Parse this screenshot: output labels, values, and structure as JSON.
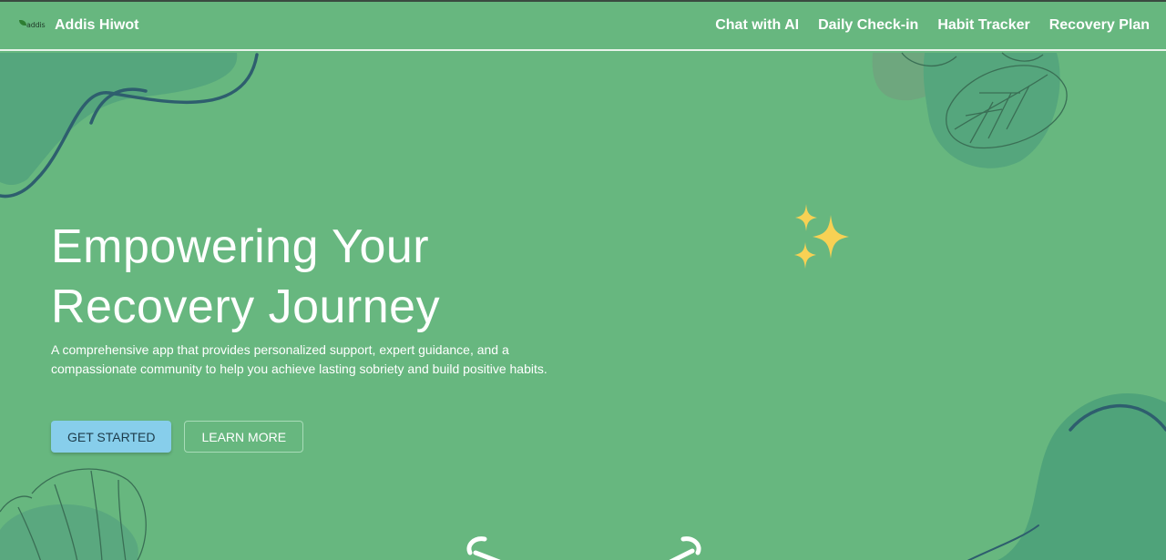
{
  "brand": {
    "logo_text": "addis",
    "name": "Addis Hiwot"
  },
  "nav": {
    "items": [
      {
        "label": "Chat with AI"
      },
      {
        "label": "Daily Check-in"
      },
      {
        "label": "Habit Tracker"
      },
      {
        "label": "Recovery Plan"
      }
    ]
  },
  "hero": {
    "title_line1": "Empowering Your",
    "title_line2": "Recovery Journey",
    "description": "A comprehensive app that provides personalized support, expert guidance, and a compassionate community to help you achieve lasting sobriety and build positive habits.",
    "primary_button": "GET STARTED",
    "secondary_button": "LEARN MORE"
  },
  "colors": {
    "background": "#67b77f",
    "blob": "#4fa37a",
    "line": "#2e5e6e",
    "sparkle": "#f7d154",
    "primary_button": "#87ceeb"
  },
  "icons": [
    "sparkles-icon",
    "leaf-illustration",
    "logo-icon"
  ]
}
